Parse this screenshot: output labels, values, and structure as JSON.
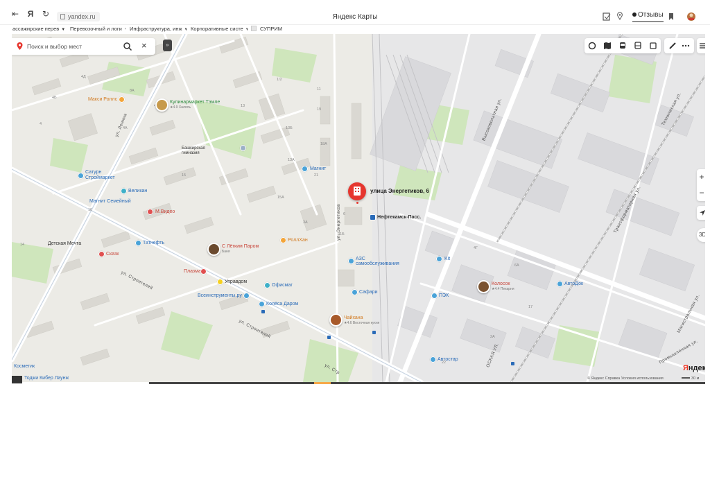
{
  "browser": {
    "url": "yandex.ru",
    "page_title": "Яндекс Карты",
    "reviews_label": "Отзывы",
    "nav": {
      "back": "⇤",
      "yandex": "Я",
      "reload": "↻"
    }
  },
  "bookmarks": [
    {
      "label": "ассажирские перев"
    },
    {
      "label": "Перевозочный и логи"
    },
    {
      "label": "Инфраструктура, инж"
    },
    {
      "label": "Корпоративные систе"
    },
    {
      "label": "СУПРИМ"
    }
  ],
  "map": {
    "search_placeholder": "Поиск и выбор мест",
    "collapse_label": "»",
    "main_place": "улица Энергетиков, 6",
    "zoom_in": "+",
    "zoom_out": "−",
    "three_d": "3D",
    "brand": {
      "first": "Я",
      "rest": "ндекс"
    },
    "copyright": "© Яндекс  Справка  Условия использования",
    "scale": "30 м",
    "streets": [
      {
        "text": "ул. Ленина"
      },
      {
        "text": "ул. Строителей"
      },
      {
        "text": "ул. Строителей"
      },
      {
        "text": "ул. Энергетиков"
      },
      {
        "text": "Высоковольтная ул."
      },
      {
        "text": "Техническая ул."
      },
      {
        "text": "Трансформаторная ул."
      },
      {
        "text": "Магистральная ул."
      },
      {
        "text": "Промышленная ул."
      },
      {
        "text": "ул. Стр"
      }
    ],
    "pois": [
      {
        "text": "Макси Роллс",
        "color": "orange"
      },
      {
        "text": "Кулинармаркет Тэмле",
        "color": "green",
        "sub": "★4.9 Халяль"
      },
      {
        "text": "Башкирская гимназия",
        "color": "dark"
      },
      {
        "text": "Магнит",
        "color": "blue"
      },
      {
        "text": "Сатурн Строймаркет",
        "color": "blue"
      },
      {
        "text": "Великан",
        "color": "blue"
      },
      {
        "text": "Магнит Семейный",
        "color": "blue"
      },
      {
        "text": "М.Видео",
        "color": "red"
      },
      {
        "text": "Татнефть",
        "color": "blue"
      },
      {
        "text": "Детская Мечта",
        "color": "dark"
      },
      {
        "text": "Сказк",
        "color": "red"
      },
      {
        "text": "С Лёгким Паром",
        "color": "red",
        "sub": "Баня"
      },
      {
        "text": "РоллХан",
        "color": "orange"
      },
      {
        "text": "Плазма",
        "color": "red"
      },
      {
        "text": "Управдом",
        "color": "dark"
      },
      {
        "text": "Офисмаг",
        "color": "blue"
      },
      {
        "text": "Всеинструменты.ру",
        "color": "blue"
      },
      {
        "text": "Колёса Даром",
        "color": "blue"
      },
      {
        "text": "Нефтекамск-Пасс.",
        "color": "dark"
      },
      {
        "text": "АЗС самообслуживания",
        "color": "blue"
      },
      {
        "text": "Kit",
        "color": "blue"
      },
      {
        "text": "Сафари",
        "color": "blue"
      },
      {
        "text": "ПЭК",
        "color": "blue"
      },
      {
        "text": "Колосок",
        "color": "red",
        "sub": "★4.4 Пекарня"
      },
      {
        "text": "АвтоДок",
        "color": "blue"
      },
      {
        "text": "Чайхана",
        "color": "orange",
        "sub": "★4.6 Восточная кухня"
      },
      {
        "text": "Автостар",
        "color": "blue"
      },
      {
        "text": "Косметик",
        "color": "blue"
      },
      {
        "text": "Тоджи Кибер Лаунж",
        "color": "blue"
      }
    ],
    "house_numbers": [
      "4Б",
      "4Д",
      "4",
      "8А",
      "11",
      "1/2",
      "13Б",
      "18А",
      "19",
      "13",
      "44",
      "4А",
      "13А",
      "15",
      "15А",
      "21",
      "19Б",
      "4В",
      "3А",
      "21Б",
      "8",
      "3",
      "6",
      "21В",
      "5",
      "4Г",
      "6А",
      "2А",
      "22",
      "17",
      "29",
      "24",
      "2/1",
      "2",
      "1",
      "1В",
      "12",
      "8",
      "10",
      "14",
      "41",
      "45/1"
    ]
  },
  "colors": {
    "map_bg": "#ecebe6",
    "park": "#cbe6b7",
    "road": "#ffffff",
    "main_road": "#c9d6e6",
    "rail": "#b8b8b8",
    "pin": "#e6362e"
  }
}
